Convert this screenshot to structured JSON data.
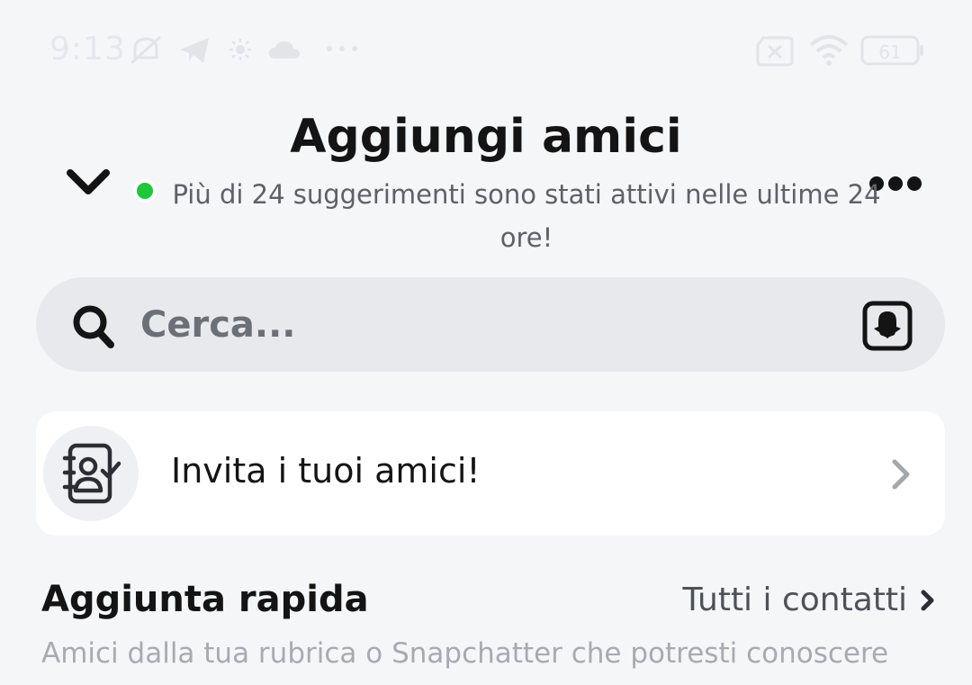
{
  "status_bar": {
    "time": "9:13",
    "battery_level": "61",
    "icons": [
      "mute-icon",
      "telegram-icon",
      "weather-sun-icon",
      "cloud-icon",
      "more-notifications-icon",
      "sim-off-icon",
      "wifi-icon",
      "battery-icon"
    ]
  },
  "header": {
    "title": "Aggiungi amici",
    "subtitle": "Più di 24 suggerimenti sono stati attivi nelle ultime 24 ore!",
    "online_color": "#20c63b"
  },
  "search": {
    "placeholder": "Cerca..."
  },
  "invite": {
    "label": "Invita i tuoi amici!"
  },
  "quick_add": {
    "title": "Aggiunta rapida",
    "link_label": "Tutti i contatti",
    "description": "Amici dalla tua rubrica o Snapchatter che potresti conoscere"
  }
}
